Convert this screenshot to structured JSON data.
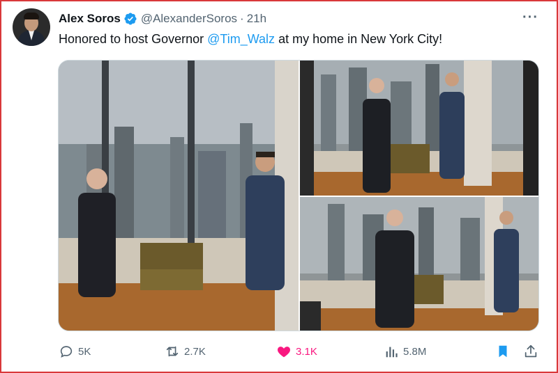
{
  "tweet": {
    "author_name": "Alex Soros",
    "handle": "@AlexanderSoros",
    "separator": "·",
    "time": "21h",
    "more_icon": "more-horizontal-icon",
    "text_before": "Honored to host Governor ",
    "mention": "@Tim_Walz",
    "text_after": " at my home in New York City!"
  },
  "colors": {
    "accent": "#1d9bf0",
    "like": "#f91880",
    "secondary_text": "#536471",
    "frame_border": "#d9383a"
  },
  "media": {
    "count": 3,
    "photos": [
      "photo-two-men-window-chair",
      "photo-men-talking-skyline",
      "photo-men-standing-room"
    ]
  },
  "actions": {
    "replies": "5K",
    "reposts": "2.7K",
    "likes": "3.1K",
    "views": "5.8M",
    "liked": true,
    "bookmarked": true
  }
}
